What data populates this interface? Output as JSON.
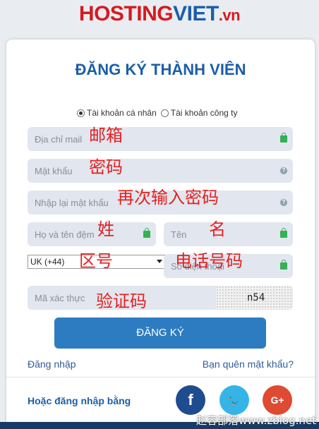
{
  "logo": {
    "part1": "HOSTING",
    "part2": "VIET",
    "part3": ".vn"
  },
  "title": "ĐĂNG KÝ THÀNH VIÊN",
  "account_types": [
    {
      "label": "Tài khoản cá nhân",
      "selected": true
    },
    {
      "label": "Tài khoản công ty",
      "selected": false
    }
  ],
  "fields": {
    "email": "Địa chỉ mail",
    "password": "Mật khẩu",
    "confirm_password": "Nhập lại mật khẩu",
    "last_name": "Họ và tên đệm",
    "first_name": "Tên",
    "country_code": "UK (+44)",
    "phone": "Số điện thoại",
    "captcha": "Mã xác thực",
    "captcha_code": "n54"
  },
  "annotations": {
    "email": "邮箱",
    "password": "密码",
    "confirm": "再次输入密码",
    "surname": "姓",
    "name": "名",
    "area_code": "区号",
    "phone": "电话号码",
    "captcha": "验证码"
  },
  "submit_label": "ĐĂNG KÝ",
  "login_link": "Đăng nhập",
  "forgot_link": "Bạn quên mật khẩu?",
  "social_label": "Hoặc đăng nhập bằng",
  "social": {
    "facebook": "f",
    "twitter": "🐦",
    "google": "G+"
  },
  "watermark": "赵容部落www.zblog.net",
  "colors": {
    "brand_blue": "#1b5ea8",
    "brand_red": "#d71920",
    "button": "#2d7cc1",
    "lock": "#31b255"
  }
}
